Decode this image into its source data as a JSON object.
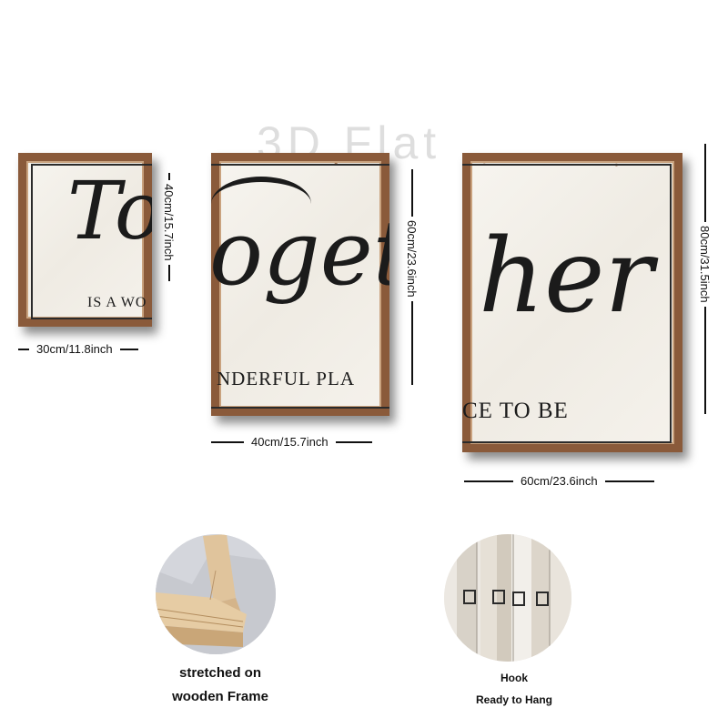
{
  "watermark": "3D Flat",
  "panels": {
    "small": {
      "script": "To",
      "caps": "IS A WO"
    },
    "medium": {
      "script": "ogeth",
      "caps": "NDERFUL PLA"
    },
    "large": {
      "script": "her",
      "caps": "CE TO BE"
    }
  },
  "dimensions": {
    "small_width": "30cm/11.8inch",
    "small_height": "40cm/15.7inch",
    "medium_width": "40cm/15.7inch",
    "medium_height": "60cm/23.6inch",
    "large_width": "60cm/23.6inch",
    "large_height": "80cm/31.5inch"
  },
  "details": {
    "frame_caption_line1": "stretched on",
    "frame_caption_line2": "wooden Frame",
    "hook_caption_line1": "Hook",
    "hook_caption_line2": "Ready to Hang"
  }
}
